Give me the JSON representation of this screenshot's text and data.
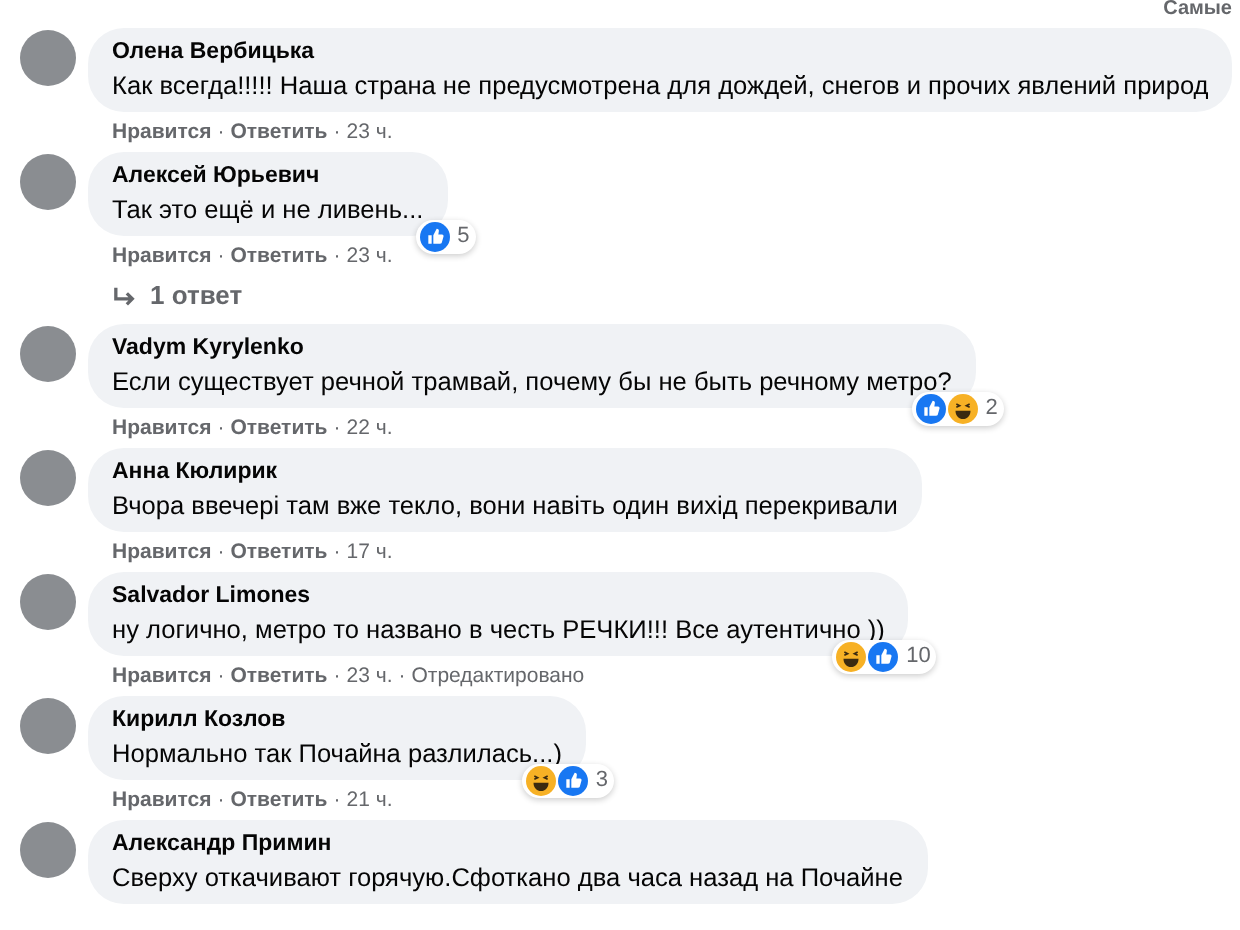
{
  "sort_label": "Самые",
  "comments": [
    {
      "author": "Олена Вербицька",
      "text": "Как всегда!!!!! Наша страна не предусмотрена для дождей, снегов и прочих явлений природ",
      "meta": [
        {
          "kind": "action",
          "text": "Нравится"
        },
        {
          "kind": "separator",
          "text": "·"
        },
        {
          "kind": "action",
          "text": "Ответить"
        },
        {
          "kind": "separator",
          "text": "·"
        },
        {
          "kind": "time",
          "text": "23 ч."
        }
      ]
    },
    {
      "author": "Алексей Юрьевич",
      "text": "Так это ещё и не ливень...",
      "meta": [
        {
          "kind": "action",
          "text": "Нравится"
        },
        {
          "kind": "separator",
          "text": "·"
        },
        {
          "kind": "action",
          "text": "Ответить"
        },
        {
          "kind": "separator",
          "text": "·"
        },
        {
          "kind": "time",
          "text": "23 ч."
        }
      ],
      "reactions": {
        "icons": [
          {
            "kind": "like"
          }
        ],
        "count": "5"
      },
      "replies_link": "1 ответ"
    },
    {
      "author": "Vadym Kyrylenko",
      "text": "Если существует речной трамвай, почему бы не быть речному метро?",
      "meta": [
        {
          "kind": "action",
          "text": "Нравится"
        },
        {
          "kind": "separator",
          "text": "·"
        },
        {
          "kind": "action",
          "text": "Ответить"
        },
        {
          "kind": "separator",
          "text": "·"
        },
        {
          "kind": "time",
          "text": "22 ч."
        }
      ],
      "reactions": {
        "icons": [
          {
            "kind": "like"
          },
          {
            "kind": "haha"
          }
        ],
        "count": "2"
      }
    },
    {
      "author": "Анна Кюлирик",
      "text": "Вчора ввечері там вже текло, вони навіть один вихід перекривали",
      "meta": [
        {
          "kind": "action",
          "text": "Нравится"
        },
        {
          "kind": "separator",
          "text": "·"
        },
        {
          "kind": "action",
          "text": "Ответить"
        },
        {
          "kind": "separator",
          "text": "·"
        },
        {
          "kind": "time",
          "text": "17 ч."
        }
      ]
    },
    {
      "author": "Salvador Limones",
      "text": "ну логично, метро то названо в честь РЕЧКИ!!! Все аутентично ))",
      "meta": [
        {
          "kind": "action",
          "text": "Нравится"
        },
        {
          "kind": "separator",
          "text": "·"
        },
        {
          "kind": "action",
          "text": "Ответить"
        },
        {
          "kind": "separator",
          "text": "·"
        },
        {
          "kind": "time",
          "text": "23 ч."
        },
        {
          "kind": "separator",
          "text": "·"
        },
        {
          "kind": "edited",
          "text": "Отредактировано"
        }
      ],
      "reactions": {
        "icons": [
          {
            "kind": "haha"
          },
          {
            "kind": "like"
          }
        ],
        "count": "10"
      }
    },
    {
      "author": "Кирилл Козлов",
      "text": "Нормально так Почайна разлилась...)",
      "meta": [
        {
          "kind": "action",
          "text": "Нравится"
        },
        {
          "kind": "separator",
          "text": "·"
        },
        {
          "kind": "action",
          "text": "Ответить"
        },
        {
          "kind": "separator",
          "text": "·"
        },
        {
          "kind": "time",
          "text": "21 ч."
        }
      ],
      "reactions": {
        "icons": [
          {
            "kind": "haha"
          },
          {
            "kind": "like"
          }
        ],
        "count": "3"
      }
    },
    {
      "author": "Александр Примин",
      "text": "Сверху откачивают горячую.Сфоткано два часа назад на Почайне"
    }
  ]
}
